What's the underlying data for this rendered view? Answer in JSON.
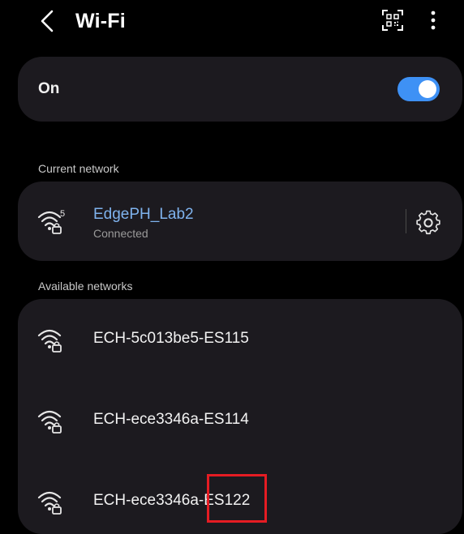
{
  "header": {
    "title": "Wi-Fi",
    "back_icon": "chevron-left-icon",
    "qr_icon": "qr-code-scan-icon",
    "more_icon": "more-vertical-icon"
  },
  "wifi_toggle": {
    "label": "On",
    "state": true,
    "accent_color": "#3e91f5"
  },
  "current_network": {
    "section_label": "Current network",
    "name": "EdgePH_Lab2",
    "status": "Connected",
    "band_badge": "5",
    "name_color": "#7fb3ee",
    "settings_icon": "gear-icon"
  },
  "available_networks": {
    "section_label": "Available networks",
    "items": [
      {
        "name": "ECH-5c013be5-ES115",
        "icon": "wifi-locked-icon"
      },
      {
        "name": "ECH-ece3346a-ES114",
        "icon": "wifi-locked-icon"
      },
      {
        "name": "ECH-ece3346a-ES122",
        "icon": "wifi-locked-icon"
      }
    ]
  },
  "highlight_color": "#e51c23"
}
